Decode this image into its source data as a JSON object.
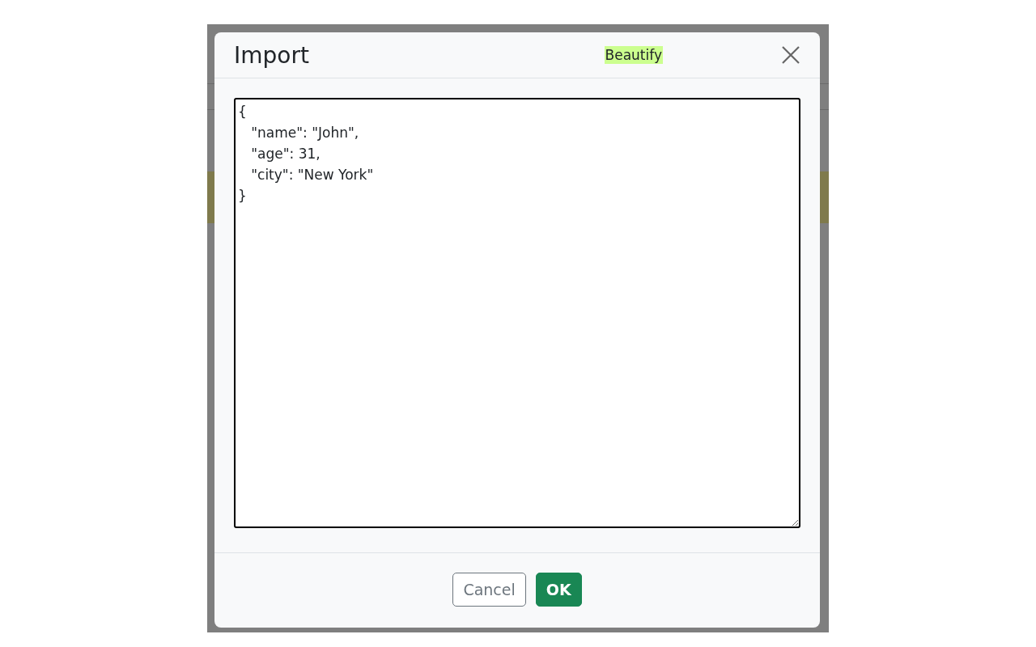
{
  "dialog": {
    "title": "Import",
    "beautify_label": "Beautify",
    "editor_value": "{\n   \"name\": \"John\",\n   \"age\": 31,\n   \"city\": \"New York\"\n}",
    "buttons": [
      {
        "label": "Cancel",
        "kind": "secondary"
      },
      {
        "label": "OK",
        "kind": "primary"
      }
    ]
  }
}
